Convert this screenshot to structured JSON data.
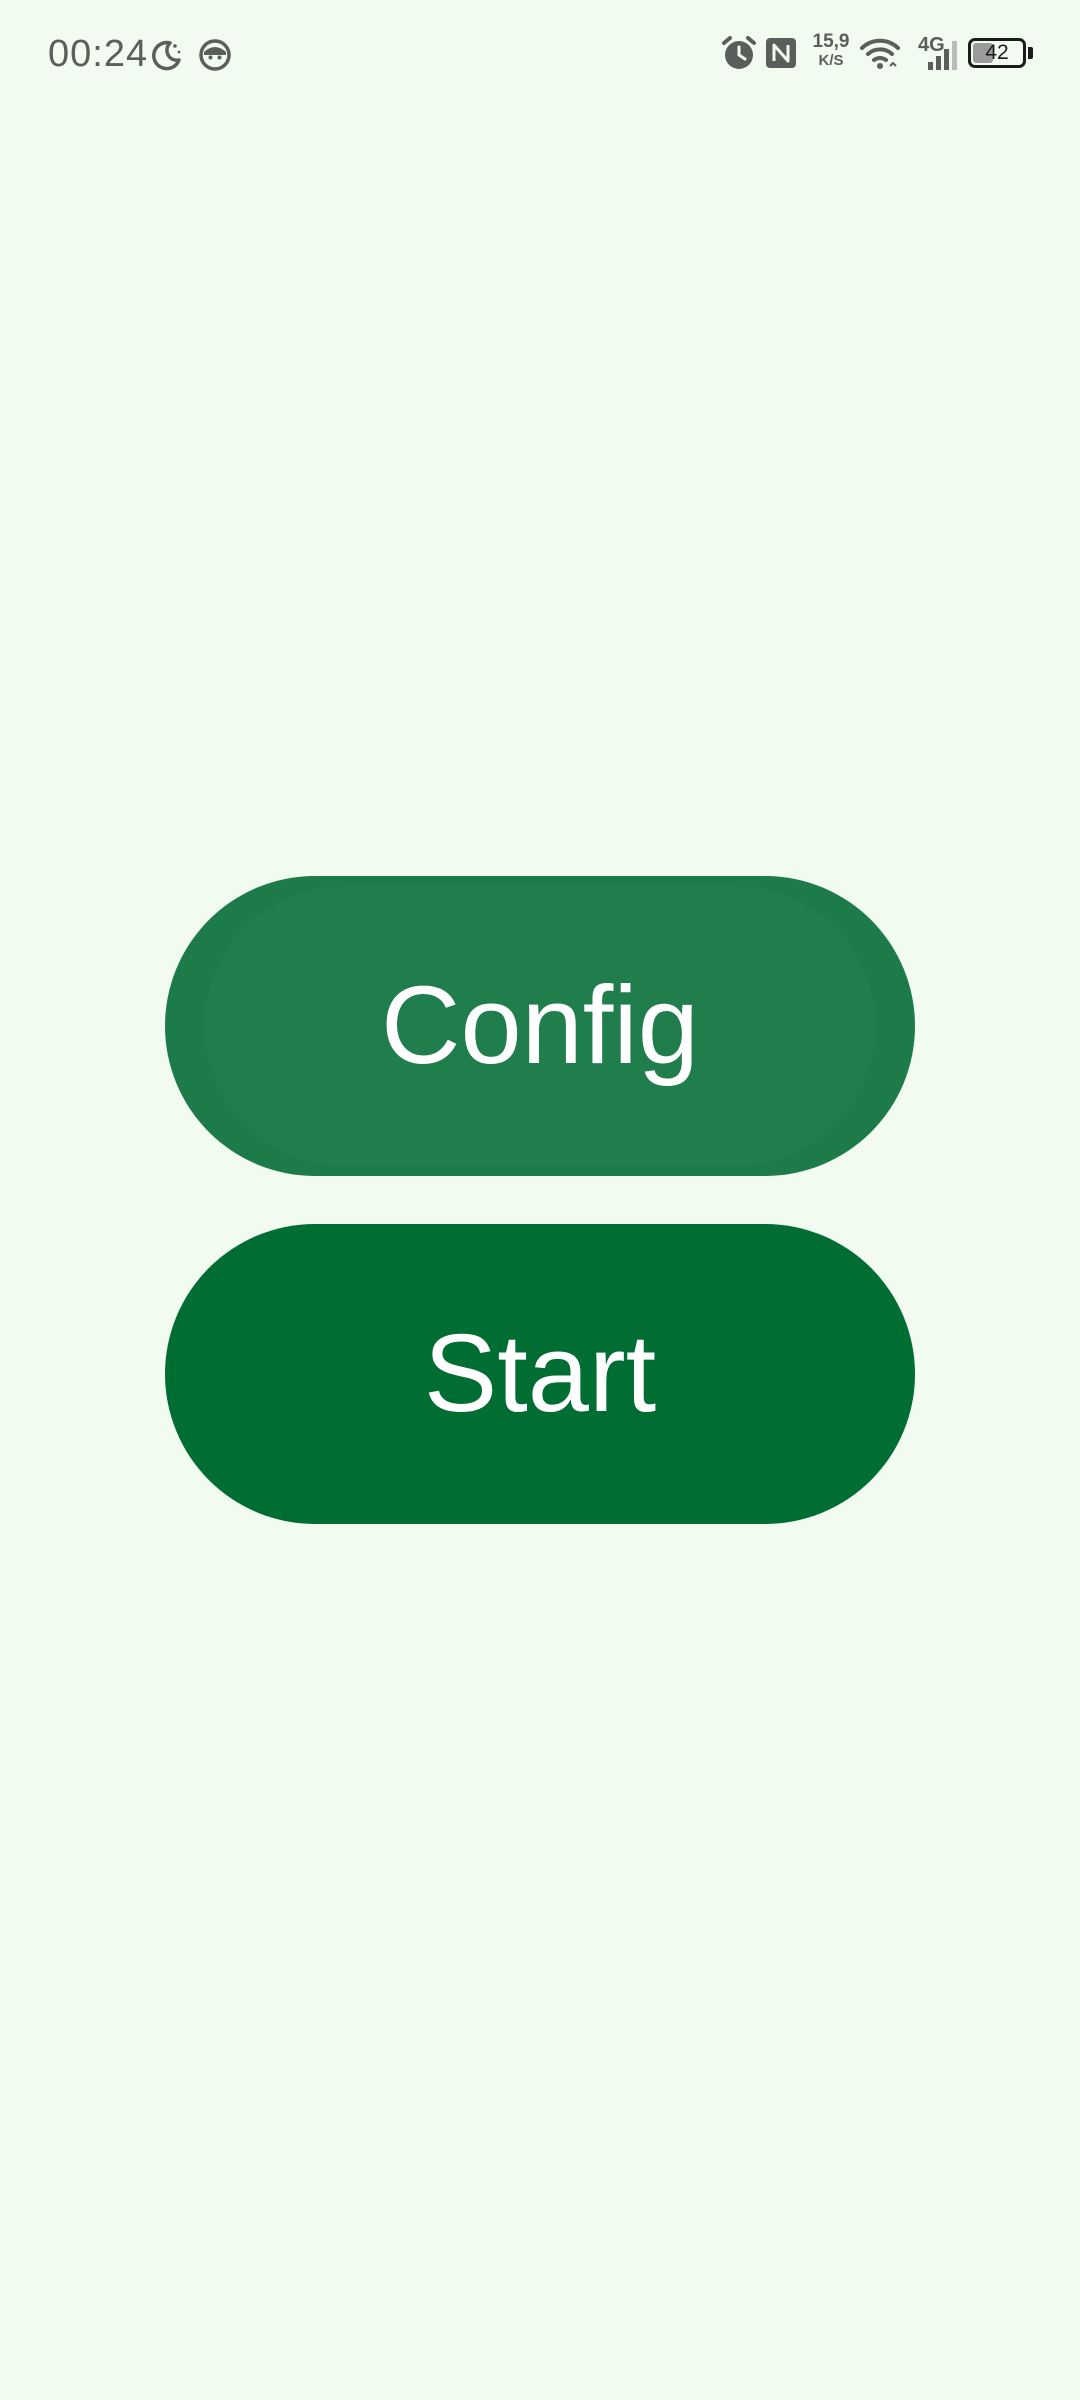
{
  "status_bar": {
    "time": "00:24",
    "network_speed_value": "15,9",
    "network_speed_unit": "K/S",
    "network_type": "4G",
    "battery_level": "42",
    "battery_percent": 42,
    "icons": [
      "moon-icon",
      "face-icon",
      "alarm-icon",
      "nfc-icon",
      "wifi-icon",
      "signal-icon",
      "battery-icon"
    ]
  },
  "buttons": {
    "config_label": "Config",
    "start_label": "Start"
  },
  "colors": {
    "background": "#f1fbf0",
    "config_button": "#1c7b49",
    "start_button": "#006d33",
    "button_text": "#ffffff",
    "status_text": "#5b5f5b"
  }
}
